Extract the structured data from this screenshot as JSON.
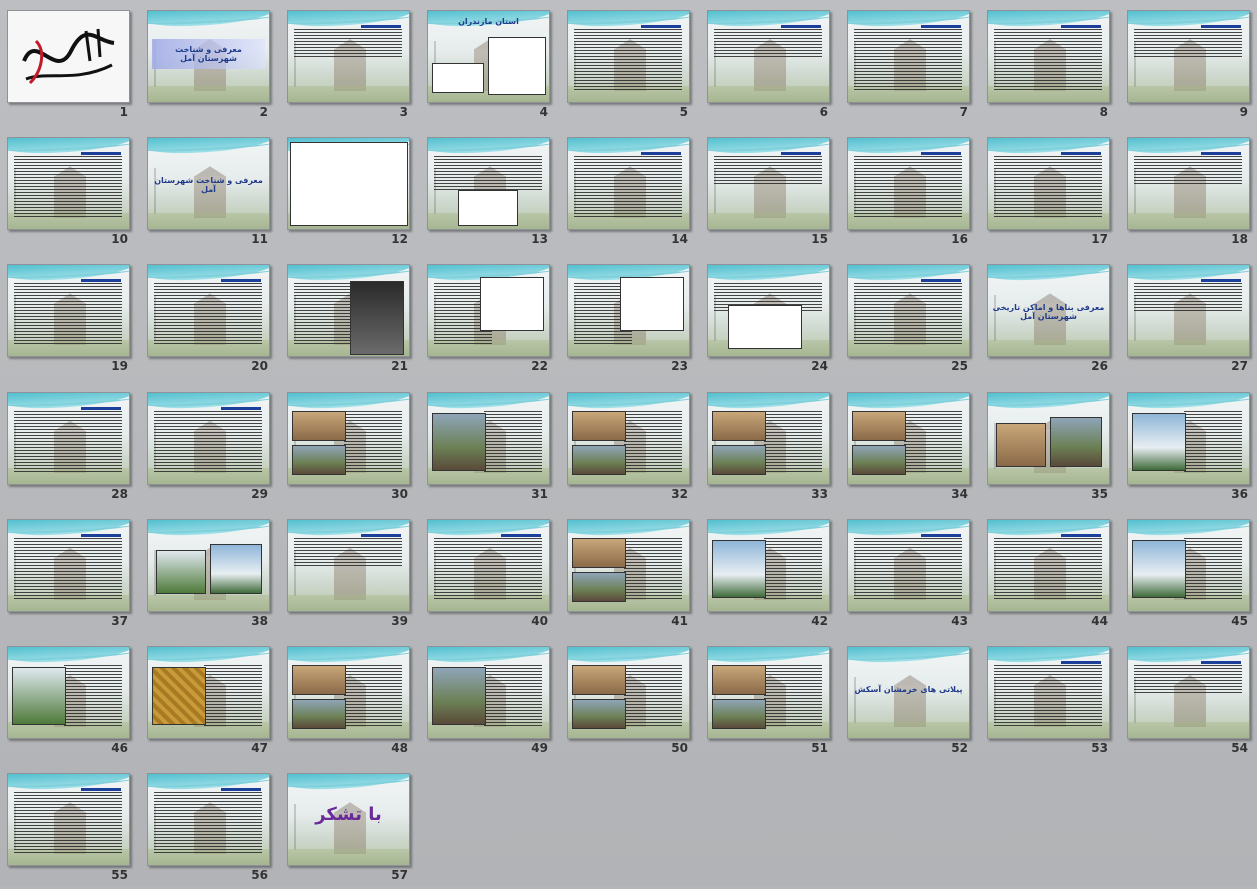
{
  "slide_sorter": {
    "slides": [
      {
        "number": "1",
        "kind": "calligraphy",
        "title": ""
      },
      {
        "number": "2",
        "kind": "title-band",
        "title": "معرفی و شناخت شهرستان  آمل"
      },
      {
        "number": "3",
        "kind": "text",
        "title": ""
      },
      {
        "number": "4",
        "kind": "maps",
        "title": "استان مازندران"
      },
      {
        "number": "5",
        "kind": "text",
        "title": ""
      },
      {
        "number": "6",
        "kind": "text",
        "title": ""
      },
      {
        "number": "7",
        "kind": "text",
        "title": ""
      },
      {
        "number": "8",
        "kind": "text",
        "title": ""
      },
      {
        "number": "9",
        "kind": "text",
        "title": ""
      },
      {
        "number": "10",
        "kind": "text",
        "title": ""
      },
      {
        "number": "11",
        "kind": "title",
        "title": "معرفی و شناخت شهرستان  آمل"
      },
      {
        "number": "12",
        "kind": "diagram",
        "title": ""
      },
      {
        "number": "13",
        "kind": "text-chart",
        "title": ""
      },
      {
        "number": "14",
        "kind": "text",
        "title": ""
      },
      {
        "number": "15",
        "kind": "text",
        "title": ""
      },
      {
        "number": "16",
        "kind": "text",
        "title": ""
      },
      {
        "number": "17",
        "kind": "text",
        "title": ""
      },
      {
        "number": "18",
        "kind": "text",
        "title": ""
      },
      {
        "number": "19",
        "kind": "text",
        "title": ""
      },
      {
        "number": "20",
        "kind": "text",
        "title": ""
      },
      {
        "number": "21",
        "kind": "text-drawing",
        "title": ""
      },
      {
        "number": "22",
        "kind": "text-map",
        "title": ""
      },
      {
        "number": "23",
        "kind": "text-map",
        "title": ""
      },
      {
        "number": "24",
        "kind": "text-plan",
        "title": ""
      },
      {
        "number": "25",
        "kind": "text",
        "title": ""
      },
      {
        "number": "26",
        "kind": "title",
        "title": "معرفی بناها و اماکن تاریخی شهرستان آمل"
      },
      {
        "number": "27",
        "kind": "text",
        "title": ""
      },
      {
        "number": "28",
        "kind": "text",
        "title": ""
      },
      {
        "number": "29",
        "kind": "text",
        "title": ""
      },
      {
        "number": "30",
        "kind": "text-photos",
        "title": ""
      },
      {
        "number": "31",
        "kind": "text-photo",
        "title": ""
      },
      {
        "number": "32",
        "kind": "text-photos",
        "title": ""
      },
      {
        "number": "33",
        "kind": "text-photos",
        "title": ""
      },
      {
        "number": "34",
        "kind": "text-photos",
        "title": ""
      },
      {
        "number": "35",
        "kind": "photos",
        "title": ""
      },
      {
        "number": "36",
        "kind": "text-photo",
        "title": ""
      },
      {
        "number": "37",
        "kind": "text",
        "title": ""
      },
      {
        "number": "38",
        "kind": "photos",
        "title": ""
      },
      {
        "number": "39",
        "kind": "text",
        "title": ""
      },
      {
        "number": "40",
        "kind": "text",
        "title": ""
      },
      {
        "number": "41",
        "kind": "text-photos",
        "title": ""
      },
      {
        "number": "42",
        "kind": "text-photo",
        "title": ""
      },
      {
        "number": "43",
        "kind": "text",
        "title": ""
      },
      {
        "number": "44",
        "kind": "text",
        "title": ""
      },
      {
        "number": "45",
        "kind": "text-photo",
        "title": ""
      },
      {
        "number": "46",
        "kind": "text-photo",
        "title": ""
      },
      {
        "number": "47",
        "kind": "text-photo",
        "title": ""
      },
      {
        "number": "48",
        "kind": "text-photos",
        "title": ""
      },
      {
        "number": "49",
        "kind": "text-photo",
        "title": ""
      },
      {
        "number": "50",
        "kind": "text-photos",
        "title": ""
      },
      {
        "number": "51",
        "kind": "text-photos",
        "title": ""
      },
      {
        "number": "52",
        "kind": "title",
        "title": "پیلاتی های خرمشان   آسکش"
      },
      {
        "number": "53",
        "kind": "text",
        "title": ""
      },
      {
        "number": "54",
        "kind": "text",
        "title": ""
      },
      {
        "number": "55",
        "kind": "text",
        "title": ""
      },
      {
        "number": "56",
        "kind": "text",
        "title": ""
      },
      {
        "number": "57",
        "kind": "thanks",
        "title": "با تشکر"
      }
    ]
  }
}
